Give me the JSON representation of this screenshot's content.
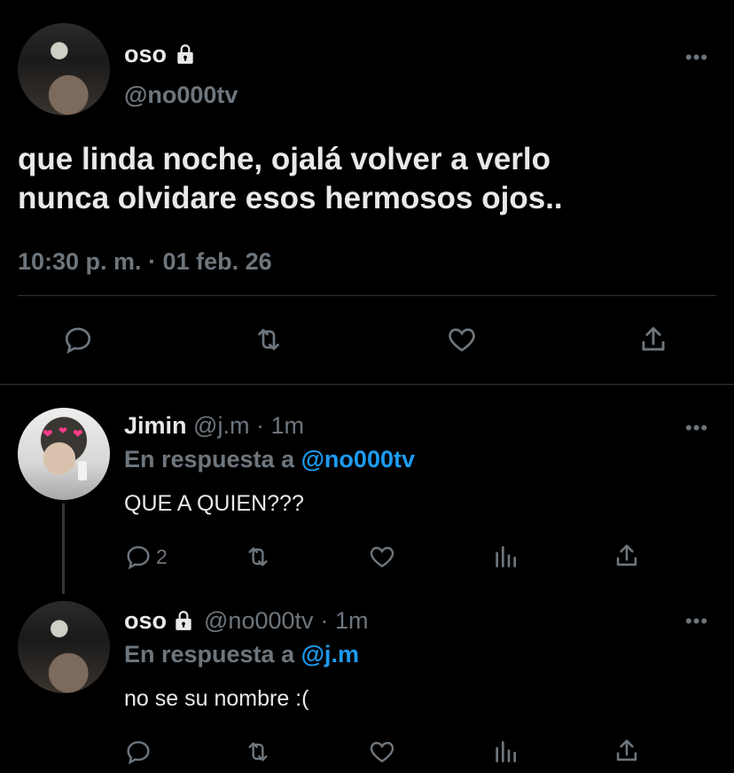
{
  "main_tweet": {
    "display_name": "oso",
    "handle": "@no000tv",
    "text_line1": "que linda noche, ojalá volver a verlo",
    "text_line2": "nunca olvidare esos hermosos ojos..",
    "timestamp": "10:30 p. m. · 01 feb. 26"
  },
  "reply1": {
    "display_name": "Jimin",
    "handle": "@j.m",
    "time": "· 1m",
    "reply_prefix": "En respuesta a",
    "reply_to": "@no000tv",
    "text": "QUE A QUIEN???",
    "reply_count": "2"
  },
  "reply2": {
    "display_name": "oso",
    "handle": "@no000tv",
    "time": "· 1m",
    "reply_prefix": "En respuesta a",
    "reply_to": "@j.m",
    "text": "no se su nombre :("
  },
  "icons": {
    "lock": "lock-icon",
    "more": "more-icon",
    "reply": "reply-icon",
    "retweet": "retweet-icon",
    "like": "heart-icon",
    "share": "share-icon",
    "analytics": "analytics-icon"
  },
  "colors": {
    "background": "#000000",
    "text": "#e7e9ea",
    "muted": "#6e767d",
    "link": "#1d9bf0"
  }
}
